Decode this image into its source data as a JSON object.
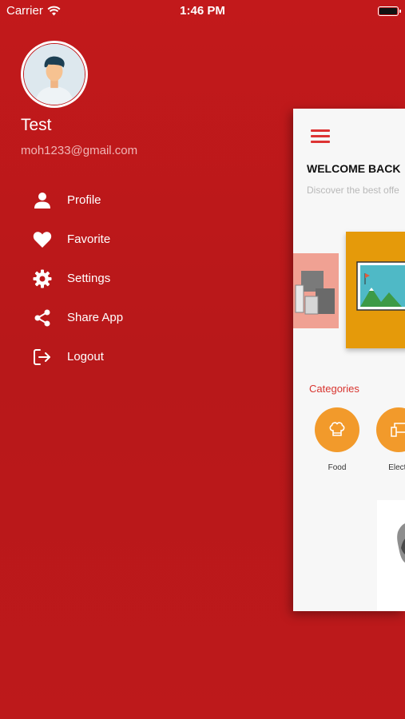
{
  "status_bar": {
    "carrier": "Carrier",
    "time": "1:46 PM"
  },
  "profile": {
    "name": "Test",
    "email": "moh1233@gmail.com"
  },
  "menu": {
    "items": [
      {
        "label": "Profile",
        "icon": "person-icon"
      },
      {
        "label": "Favorite",
        "icon": "heart-icon"
      },
      {
        "label": "Settings",
        "icon": "gear-icon"
      },
      {
        "label": "Share App",
        "icon": "share-icon"
      },
      {
        "label": "Logout",
        "icon": "logout-icon"
      }
    ]
  },
  "preview": {
    "welcome": "WELCOME BACK",
    "discover": "Discover the best offe",
    "categories_title": "Categories",
    "categories": [
      {
        "label": "Food",
        "icon": "chef-hat-icon"
      },
      {
        "label": "Electr",
        "icon": "devices-icon"
      }
    ]
  },
  "colors": {
    "background": "#bd1a1c",
    "accent": "#d33333",
    "category": "#f29a2b",
    "slide": "#e59a0a"
  }
}
